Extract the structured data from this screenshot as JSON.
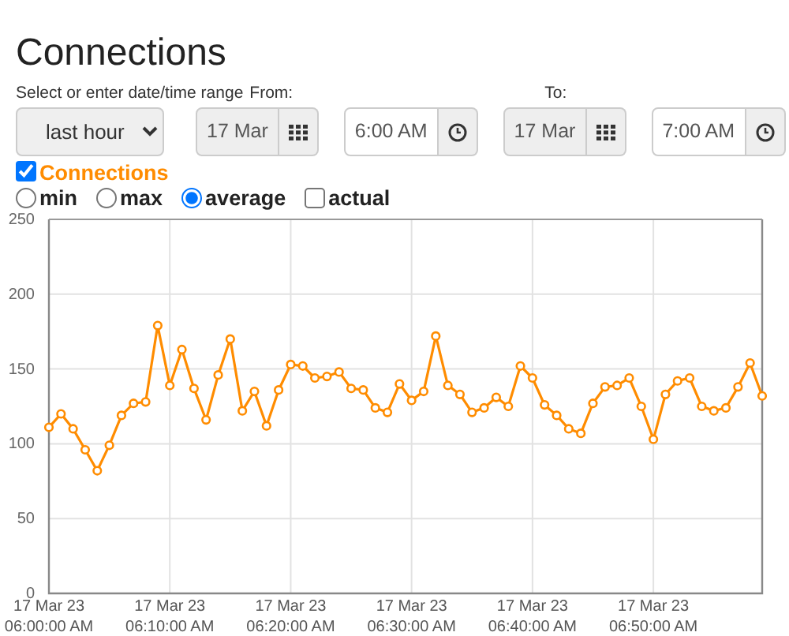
{
  "title": "Connections",
  "range": {
    "label": "Select or enter date/time range",
    "value": "last hour"
  },
  "from": {
    "label": "From:",
    "date": "17 Mar",
    "time": "6:00 AM"
  },
  "to": {
    "label": "To:",
    "date": "17 Mar",
    "time": "7:00 AM"
  },
  "series_toggle": {
    "checked": true
  },
  "modes": [
    {
      "kind": "radio",
      "label": "min",
      "selected": false
    },
    {
      "kind": "radio",
      "label": "max",
      "selected": false
    },
    {
      "kind": "radio",
      "label": "average",
      "selected": true
    },
    {
      "kind": "checkbox",
      "label": "actual",
      "selected": false
    }
  ],
  "chart": {
    "chart_data": {
      "type": "line",
      "categories": [
        "17 Mar 23\n06:00:00 AM",
        null,
        null,
        null,
        null,
        null,
        null,
        null,
        null,
        null,
        "17 Mar 23\n06:10:00 AM",
        null,
        null,
        null,
        null,
        null,
        null,
        null,
        null,
        null,
        "17 Mar 23\n06:20:00 AM",
        null,
        null,
        null,
        null,
        null,
        null,
        null,
        null,
        null,
        "17 Mar 23\n06:30:00 AM",
        null,
        null,
        null,
        null,
        null,
        null,
        null,
        null,
        null,
        "17 Mar 23\n06:40:00 AM",
        null,
        null,
        null,
        null,
        null,
        null,
        null,
        null,
        null,
        "17 Mar 23\n06:50:00 AM",
        null,
        null,
        null,
        null,
        null,
        null,
        null,
        null,
        null
      ],
      "grid": true,
      "series": [
        {
          "name": "Connections",
          "color": "#ff8c00",
          "marker": "circle",
          "values": [
            111,
            120,
            110,
            96,
            82,
            99,
            119,
            127,
            128,
            179,
            139,
            163,
            137,
            116,
            146,
            170,
            122,
            135,
            112,
            136,
            153,
            152,
            144,
            145,
            148,
            137,
            136,
            124,
            121,
            140,
            129,
            135,
            172,
            139,
            133,
            121,
            124,
            131,
            125,
            152,
            144,
            126,
            119,
            110,
            107,
            127,
            138,
            139,
            144,
            125,
            103,
            133,
            142,
            144,
            125,
            122,
            124,
            138,
            154,
            132
          ]
        }
      ],
      "ylim": [
        0,
        250
      ],
      "yticks": [
        0,
        50,
        100,
        150,
        200,
        250
      ]
    }
  }
}
